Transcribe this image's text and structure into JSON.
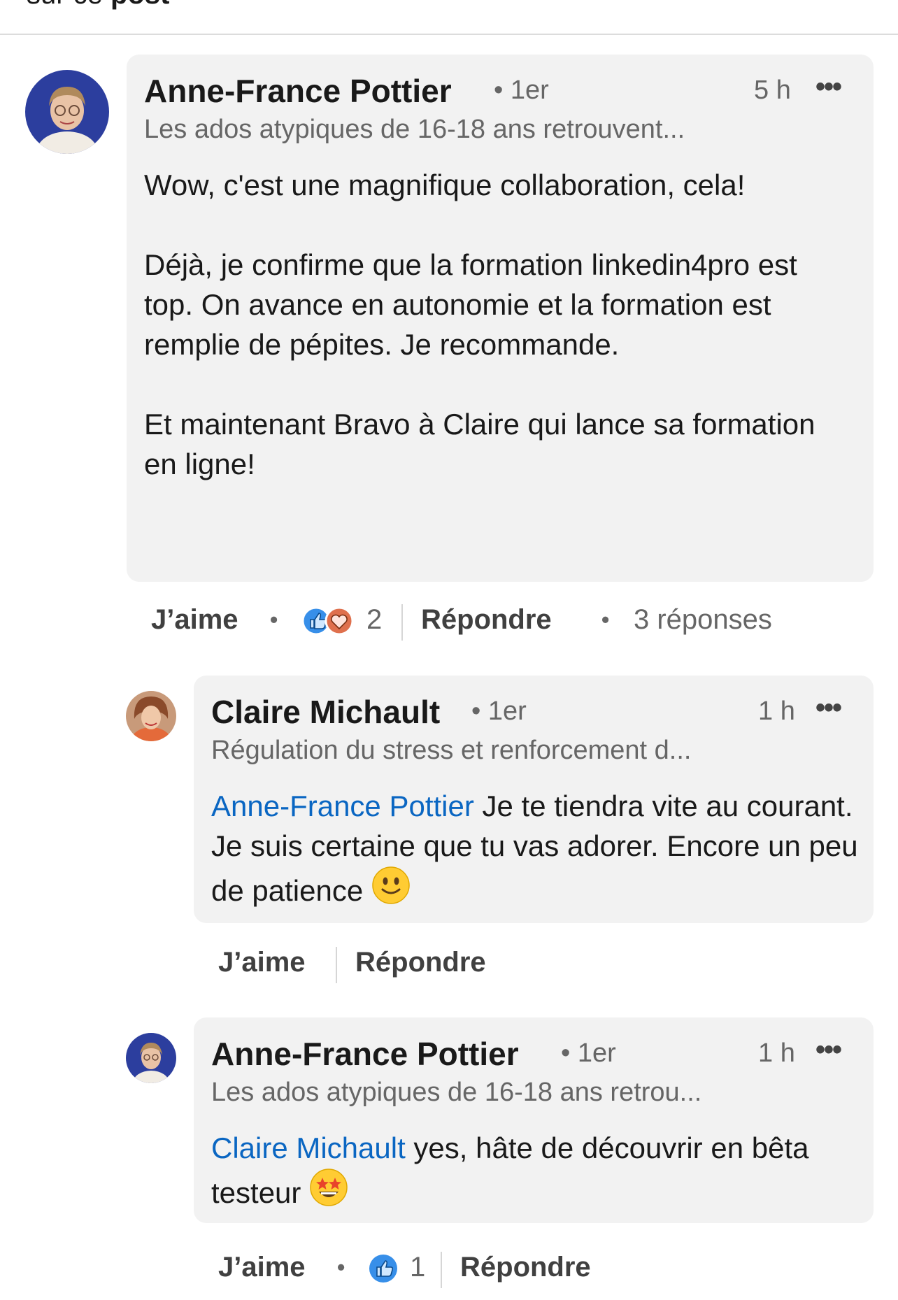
{
  "header": {
    "title_plain": "sur ce ",
    "title_bold": "post"
  },
  "comments": [
    {
      "author": "Anne-France Pottier",
      "degree": "• 1er",
      "time": "5 h",
      "headline": "Les ados atypiques de 16-18 ans retrouvent...",
      "paragraphs": [
        "Wow, c'est une magnifique collaboration, cela!",
        "Déjà, je confirme que la formation linkedin4pro est top. On avance en autonomie et la formation est remplie de pépites. Je recommande.",
        "Et maintenant Bravo à Claire qui lance sa formation en ligne!"
      ],
      "actions": {
        "like": "J’aime",
        "reaction_count": "2",
        "reply": "Répondre",
        "replies": "3 réponses"
      }
    },
    {
      "author": "Claire Michault",
      "degree": "• 1er",
      "time": "1 h",
      "headline": "Régulation du stress et renforcement d...",
      "mention": "Anne-France Pottier",
      "text": " Je te tiendra vite au courant.  Je suis certaine que tu vas adorer.  Encore un peu de patience ",
      "emoji": "slightly-smiling-face",
      "actions": {
        "like": "J’aime",
        "reply": "Répondre"
      }
    },
    {
      "author": "Anne-France Pottier",
      "degree": "• 1er",
      "time": "1 h",
      "headline": "Les ados atypiques de 16-18 ans retrou...",
      "mention": "Claire Michault",
      "text": " yes, hâte de découvrir en bêta testeur ",
      "emoji": "star-struck-face",
      "actions": {
        "like": "J’aime",
        "reaction_count": "1",
        "reply": "Répondre"
      }
    }
  ],
  "colors": {
    "bubble": "#f2f2f2",
    "mention": "#0a66c2",
    "secondary_text": "#666666",
    "avatar_bg": "#2c3e9e"
  }
}
